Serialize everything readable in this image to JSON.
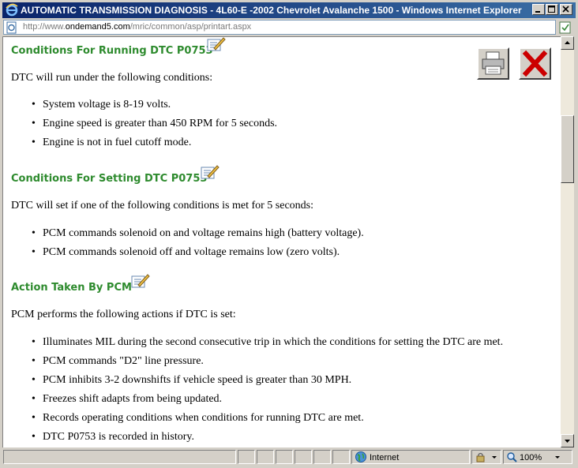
{
  "window": {
    "title": "AUTOMATIC TRANSMISSION DIAGNOSIS - 4L60-E -2002 Chevrolet Avalanche 1500 - Windows Internet Explorer"
  },
  "address": {
    "prefix": "http://www.",
    "host": "ondemand5.com",
    "path": "/mric/common/asp/printart.aspx"
  },
  "sections": [
    {
      "heading": "Conditions For Running DTC P0753",
      "intro": "DTC will run under the following conditions:",
      "items": [
        "System voltage is 8-19 volts.",
        "Engine speed is greater than 450 RPM for 5 seconds.",
        "Engine is not in fuel cutoff mode."
      ]
    },
    {
      "heading": "Conditions For Setting DTC P0753",
      "intro": "DTC will set if one of the following conditions is met for 5 seconds:",
      "items": [
        "PCM commands solenoid on and voltage remains high (battery voltage).",
        "PCM commands solenoid off and voltage remains low (zero volts)."
      ]
    },
    {
      "heading": "Action Taken By PCM",
      "intro": "PCM performs the following actions if DTC is set:",
      "items": [
        "Illuminates MIL during the second consecutive trip in which the conditions for setting the DTC are met.",
        "PCM commands \"D2\" line pressure.",
        "PCM inhibits 3-2 downshifts if vehicle speed is greater than 30 MPH.",
        "Freezes shift adapts from being updated.",
        "Records operating conditions when conditions for running DTC are met.",
        "DTC P0753 is recorded in history."
      ]
    }
  ],
  "status": {
    "zone": "Internet",
    "zoom": "100%"
  },
  "colors": {
    "heading": "#2e8b2e",
    "close_red": "#cc0000"
  }
}
